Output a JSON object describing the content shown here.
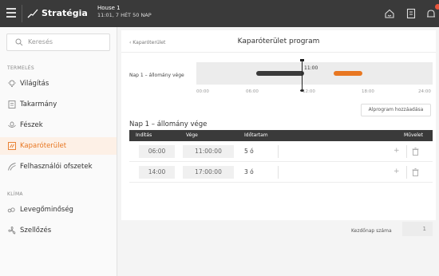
{
  "topbar": {
    "app_title": "Stratégia",
    "house_name": "House 1",
    "house_info": "11:01, 7 HÉT 50 NAP"
  },
  "sidebar": {
    "search_placeholder": "Keresés",
    "section_production": "TERMELÉS",
    "section_climate": "KLÍMA",
    "items": [
      {
        "label": "Világítás",
        "icon": "bulb-icon"
      },
      {
        "label": "Takarmány",
        "icon": "feed-icon"
      },
      {
        "label": "Fészek",
        "icon": "nest-icon"
      },
      {
        "label": "Kaparóterület",
        "icon": "scratch-area-icon",
        "active": true
      },
      {
        "label": "Felhasználói ofszetek",
        "icon": "user-offset-icon"
      },
      {
        "label": "Levegőminőség",
        "icon": "air-quality-icon"
      },
      {
        "label": "Szellőzés",
        "icon": "ventilation-icon"
      }
    ]
  },
  "main": {
    "breadcrumb": "‹ Kaparóterület",
    "title": "Kaparóterület program",
    "timeline": {
      "label": "Nap 1 – állomány vége",
      "ticks": [
        "00:00",
        "06:00",
        "12:00",
        "18:00",
        "24:00"
      ],
      "now": "11:00"
    },
    "add_subprogram": "Alprogram hozzáadása",
    "section_title": "Nap 1 – állomány vége",
    "table": {
      "headers": [
        "Indítás",
        "Vége",
        "Időtartam",
        "Művelet"
      ],
      "rows": [
        {
          "start": "06:00",
          "end": "11:00:00",
          "duration": "5 ó"
        },
        {
          "start": "14:00",
          "end": "17:00:00",
          "duration": "3 ó"
        }
      ]
    },
    "start_day_label": "Kezdőnap száma",
    "start_day_value": "1"
  },
  "colors": {
    "accent": "#e87722",
    "dark": "#3a3a3a"
  }
}
